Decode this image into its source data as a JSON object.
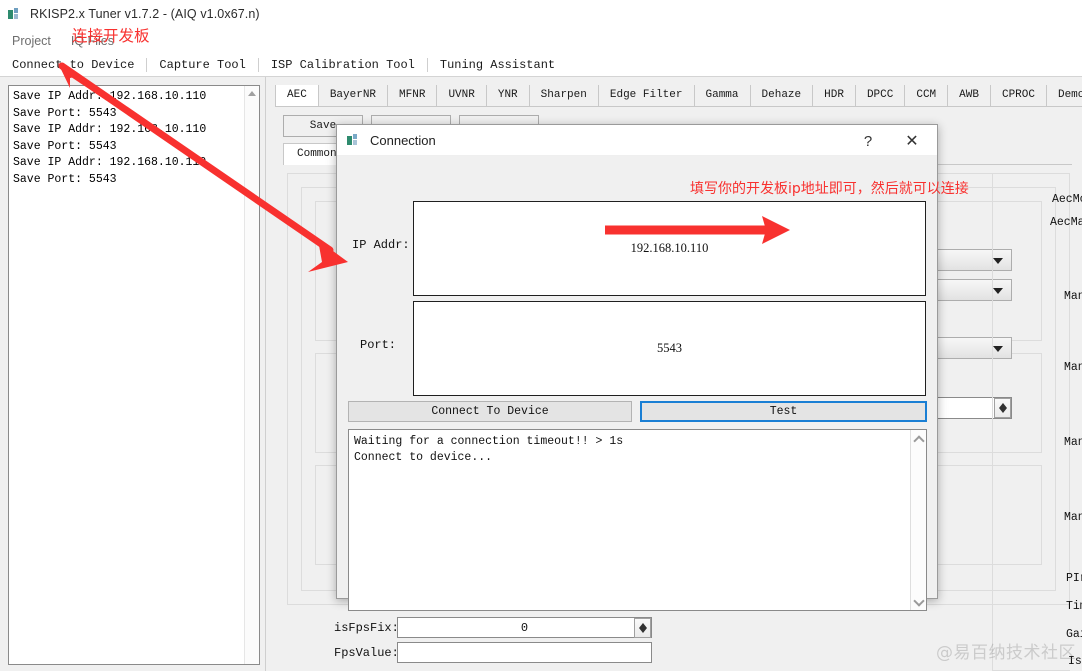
{
  "window": {
    "title": "RKISP2.x Tuner v1.7.2 - (AIQ v1.0x67.n)",
    "icon": "app-icon"
  },
  "menubar": {
    "items": [
      {
        "label": "Project"
      },
      {
        "label": "IQ Files"
      }
    ]
  },
  "toolbar": {
    "items": [
      {
        "label": "Connect to Device"
      },
      {
        "label": "Capture Tool"
      },
      {
        "label": "ISP Calibration Tool"
      },
      {
        "label": "Tuning Assistant"
      }
    ]
  },
  "log_panel": {
    "text": "Save IP Addr: 192.168.10.110\nSave Port: 5543\nSave IP Addr: 192.168.10.110\nSave Port: 5543\nSave IP Addr: 192.168.10.110\nSave Port: 5543"
  },
  "tabs": {
    "active": "AEC",
    "items": [
      {
        "label": "AEC"
      },
      {
        "label": "BayerNR"
      },
      {
        "label": "MFNR"
      },
      {
        "label": "UVNR"
      },
      {
        "label": "YNR"
      },
      {
        "label": "Sharpen"
      },
      {
        "label": "Edge Filter"
      },
      {
        "label": "Gamma"
      },
      {
        "label": "Dehaze"
      },
      {
        "label": "HDR"
      },
      {
        "label": "DPCC"
      },
      {
        "label": "CCM"
      },
      {
        "label": "AWB"
      },
      {
        "label": "CPROC"
      },
      {
        "label": "Demosaic"
      }
    ]
  },
  "sub_buttons": [
    {
      "label": "Save"
    },
    {
      "label": ""
    },
    {
      "label": ""
    }
  ],
  "inner_tab": {
    "label": "Common"
  },
  "right_labels": [
    {
      "label": "AecMo"
    },
    {
      "label": "AecMa"
    },
    {
      "label": "Man"
    },
    {
      "label": "Man"
    },
    {
      "label": "Man"
    },
    {
      "label": "Man"
    },
    {
      "label": "PIr"
    },
    {
      "label": "Tim"
    },
    {
      "label": "Gai"
    },
    {
      "label": "Isp"
    }
  ],
  "bottom_fields": [
    {
      "label": "isFpsFix:",
      "value": "0",
      "has_spinner": true
    },
    {
      "label": "FpsValue:",
      "value": "",
      "has_spinner": false
    }
  ],
  "dialog": {
    "title": "Connection",
    "help_label": "?",
    "close_label": "✕",
    "ip_label": "IP Addr:",
    "ip_value": "192.168.10.110",
    "port_label": "Port:",
    "port_value": "5543",
    "connect_button": "Connect To Device",
    "test_button": "Test",
    "log_text": "Waiting for a connection timeout!! > 1s\nConnect to device..."
  },
  "annotations": {
    "menu_note": "连接开发板",
    "ip_note": "填写你的开发板ip地址即可，然后就可以连接",
    "color": "#f8312f"
  },
  "watermark": {
    "text": "@易百纳技术社区"
  }
}
